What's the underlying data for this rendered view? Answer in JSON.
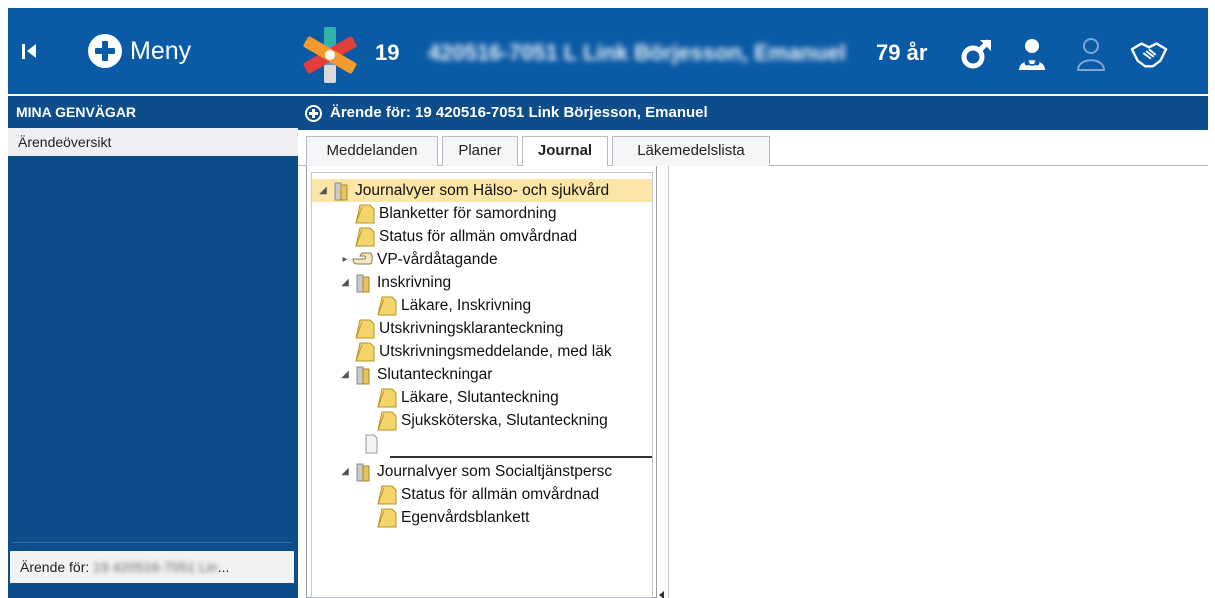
{
  "header": {
    "menu_label": "Meny",
    "patient_id": "19",
    "patient_name_blurred": "420516-7051 L Link Börjesson, Emanuel",
    "patient_age": "79 år"
  },
  "sidebar": {
    "title": "MINA GENVÄGAR",
    "items": [
      {
        "label": "Ärendeöversikt"
      }
    ],
    "bottom_prefix": "Ärende för:",
    "bottom_blurred": "19 420516-7051 Lin",
    "bottom_suffix": "..."
  },
  "case_header": {
    "title": "Ärende för: 19 420516-7051 Link Börjesson, Emanuel"
  },
  "tabs": [
    {
      "label": "Meddelanden"
    },
    {
      "label": "Planer"
    },
    {
      "label": "Journal"
    },
    {
      "label": "Läkemedelslista"
    }
  ],
  "tree": {
    "nodes": [
      {
        "label": "Journalvyer som Hälso- och sjukvård"
      },
      {
        "label": "Blanketter för samordning"
      },
      {
        "label": "Status för allmän omvårdnad"
      },
      {
        "label": "VP-vårdåtagande"
      },
      {
        "label": "Inskrivning"
      },
      {
        "label": "Läkare, Inskrivning"
      },
      {
        "label": "Utskrivningsklaranteckning"
      },
      {
        "label": "Utskrivningsmeddelande, med läk"
      },
      {
        "label": "Slutanteckningar"
      },
      {
        "label": "Läkare, Slutanteckning"
      },
      {
        "label": "Sjuksköterska, Slutanteckning"
      },
      {
        "label": "Journalvyer som Socialtjänstpersc"
      },
      {
        "label": "Status för allmän omvårdnad"
      },
      {
        "label": "Egenvårdsblankett"
      }
    ]
  },
  "colors": {
    "header_bg": "#0b5aa6",
    "sidebar_bg": "#0d4d8c",
    "selected_row": "#fbe6a8"
  },
  "icons": {
    "first": "first-page-icon",
    "menu": "plus-circle-icon",
    "logo": "star-of-life-logo",
    "male": "male-icon",
    "doctor": "doctor-icon",
    "user": "user-outline-icon",
    "handshake": "handshake-icon",
    "doc": "document-icon",
    "folder": "folder-icon",
    "hand": "pointing-hand-icon"
  }
}
